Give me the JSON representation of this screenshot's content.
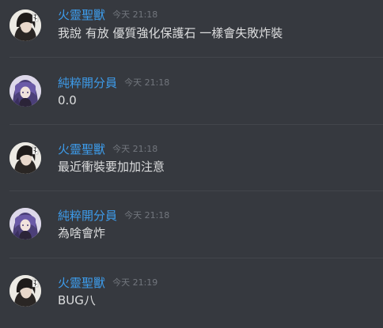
{
  "colors": {
    "background": "#36393f",
    "username": "#3d9be9",
    "timestamp": "#72767d",
    "text": "#dcddde",
    "divider": "#42454b"
  },
  "messages": [
    {
      "author": "火靈聖獸",
      "timestamp": "今天 21:18",
      "text": "我說 有放 優質強化保護石 一樣會失敗炸裝",
      "avatar_icon": "fire-spirit-avatar"
    },
    {
      "author": "純粹開分員",
      "timestamp": "今天 21:18",
      "text": "0.0",
      "avatar_icon": "purple-hair-avatar"
    },
    {
      "author": "火靈聖獸",
      "timestamp": "今天 21:18",
      "text": "最近衝裝要加加注意",
      "avatar_icon": "fire-spirit-avatar"
    },
    {
      "author": "純粹開分員",
      "timestamp": "今天 21:18",
      "text": "為啥會炸",
      "avatar_icon": "purple-hair-avatar"
    },
    {
      "author": "火靈聖獸",
      "timestamp": "今天 21:19",
      "text": "BUG八",
      "avatar_icon": "fire-spirit-avatar"
    }
  ]
}
